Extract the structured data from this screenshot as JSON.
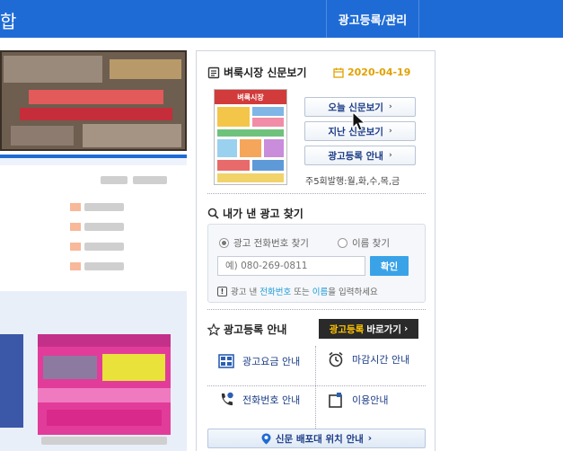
{
  "header": {
    "title_fragment": "합",
    "ad_manage_label": "광고등록/관리"
  },
  "newspaper": {
    "section_title": "벼룩시장 신문보기",
    "date": "2020-04-19",
    "thumbnail_masthead": "벼룩시장",
    "today_label": "오늘 신문보기",
    "past_label": "지난 신문보기",
    "ad_info_label": "광고등록 안내",
    "publish_info": "주5회발행:월,화,수,목,금"
  },
  "find_ad": {
    "section_title": "내가 낸 광고 찾기",
    "radio_phone": "광고 전화번호 찾기",
    "radio_name": "이름 찾기",
    "phone_placeholder": "예) 080-269-0811",
    "confirm_label": "확인",
    "hint_prefix": "광고 낸 ",
    "hint_phone": "전화번호",
    "hint_or": " 또는 ",
    "hint_name": "이름",
    "hint_suffix": "을 입력하세요"
  },
  "ad_guide": {
    "section_title": "광고등록 안내",
    "goto_highlight": "광고등록",
    "goto_rest": "바로가기",
    "items": [
      "광고요금 안내",
      "마감시간 안내",
      "전화번호 안내",
      "이용안내"
    ],
    "map_label": "신문 배포대 위치 안내"
  },
  "colors": {
    "brand_blue": "#1e6bd6",
    "date_orange": "#e2a100",
    "confirm_blue": "#3aa3e8"
  }
}
